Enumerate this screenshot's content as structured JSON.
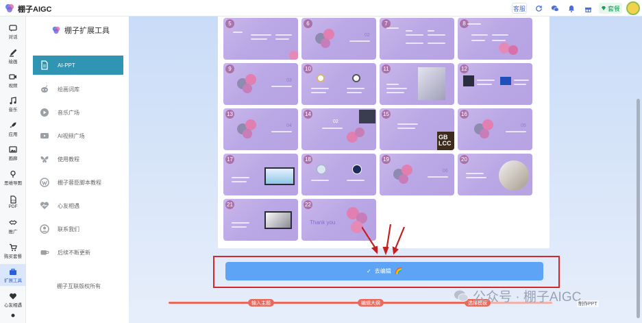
{
  "app": {
    "title": "棚子AIGC"
  },
  "topbar": {
    "service_label": "客服",
    "package_label": "套餐",
    "icons": [
      "refresh-icon",
      "wechat-icon",
      "bell-icon",
      "gift-icon"
    ],
    "accent": "#4a6fd8",
    "package_color": "#18a058"
  },
  "rail": {
    "items": [
      {
        "label": "对话",
        "icon": "chat-icon"
      },
      {
        "label": "绘画",
        "icon": "brush-icon"
      },
      {
        "label": "视频",
        "icon": "video-icon"
      },
      {
        "label": "音乐",
        "icon": "music-icon"
      },
      {
        "label": "应用",
        "icon": "rocket-icon"
      },
      {
        "label": "画廊",
        "icon": "gallery-icon"
      },
      {
        "label": "思维导图",
        "icon": "mindmap-icon"
      },
      {
        "label": "PDF",
        "icon": "pdf-icon"
      },
      {
        "label": "推广",
        "icon": "handshake-icon"
      },
      {
        "label": "购买套餐",
        "icon": "cart-icon"
      },
      {
        "label": "扩展工具",
        "icon": "toolbox-icon",
        "active": true
      },
      {
        "label": "心友相遇",
        "icon": "heart-icon"
      }
    ]
  },
  "sidebar": {
    "title": "棚子扩展工具",
    "items": [
      {
        "label": "AI-PPT",
        "icon": "document-icon",
        "active": true
      },
      {
        "label": "绘画词库",
        "icon": "robot-icon"
      },
      {
        "label": "音乐广场",
        "icon": "play-icon"
      },
      {
        "label": "AI视频广场",
        "icon": "youtube-icon"
      },
      {
        "label": "使用教程",
        "icon": "butterfly-icon"
      },
      {
        "label": "棚子蓉臣脚本教程",
        "icon": "wordpress-icon"
      },
      {
        "label": "心友相遇",
        "icon": "heartbeat-icon"
      },
      {
        "label": "联系我们",
        "icon": "user-icon"
      },
      {
        "label": "后续不断更新",
        "icon": "coffee-icon"
      }
    ],
    "copyright": "棚子互联版权所有",
    "active_color": "#2f95b3"
  },
  "slides": {
    "items": [
      {
        "num": "5",
        "type": "text"
      },
      {
        "num": "6",
        "type": "section",
        "section_no": "02"
      },
      {
        "num": "7",
        "type": "text"
      },
      {
        "num": "8",
        "type": "text"
      },
      {
        "num": "9",
        "type": "section",
        "section_no": "03"
      },
      {
        "num": "10",
        "type": "icons"
      },
      {
        "num": "11",
        "type": "photo"
      },
      {
        "num": "12",
        "type": "photos"
      },
      {
        "num": "13",
        "type": "section",
        "section_no": "04"
      },
      {
        "num": "14",
        "type": "section2",
        "section_no": "02"
      },
      {
        "num": "15",
        "type": "logo",
        "logo_text": "GB\nLCC"
      },
      {
        "num": "16",
        "type": "section",
        "section_no": "05"
      },
      {
        "num": "17",
        "type": "screen"
      },
      {
        "num": "18",
        "type": "icons2"
      },
      {
        "num": "19",
        "type": "section",
        "section_no": "06"
      },
      {
        "num": "20",
        "type": "photo-round"
      },
      {
        "num": "21",
        "type": "screen2"
      },
      {
        "num": "22",
        "type": "thanks",
        "thanks_text": "Thank you"
      }
    ]
  },
  "actions": {
    "go_edit_label": "去编辑"
  },
  "progress": {
    "fill_fraction": 0.83,
    "steps": [
      "输入主题",
      "编辑大纲",
      "选择模板"
    ],
    "export_label": "制作PPT"
  },
  "watermark": {
    "text": "公众号 · 棚子AIGC"
  }
}
